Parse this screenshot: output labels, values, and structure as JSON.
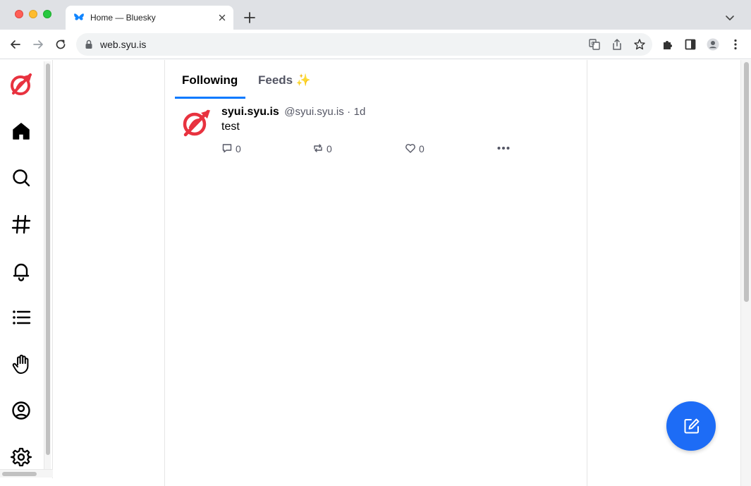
{
  "browser": {
    "tab_title": "Home — Bluesky",
    "url": "web.syu.is"
  },
  "feed": {
    "tabs": [
      {
        "label": "Following",
        "active": true
      },
      {
        "label": "Feeds ✨",
        "active": false
      }
    ],
    "posts": [
      {
        "display_name": "syui.syu.is",
        "handle": "@syui.syu.is",
        "separator": "·",
        "age": "1d",
        "text": "test",
        "reply_count": "0",
        "repost_count": "0",
        "like_count": "0"
      }
    ]
  },
  "colors": {
    "accent": "#0a7aff",
    "fab": "#1d6cf6",
    "logo_red": "#e8323f"
  },
  "icons": [
    "home-icon",
    "search-icon",
    "hash-icon",
    "bell-icon",
    "list-icon",
    "hand-icon",
    "profile-icon",
    "settings-icon"
  ]
}
